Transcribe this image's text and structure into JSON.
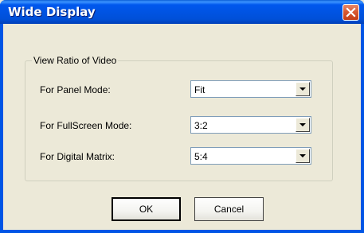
{
  "window": {
    "title": "Wide Display"
  },
  "group": {
    "title": "View Ratio of Video"
  },
  "rows": [
    {
      "label": "For Panel Mode:",
      "value": "Fit"
    },
    {
      "label": "For FullScreen Mode:",
      "value": "3:2"
    },
    {
      "label": "For Digital Matrix:",
      "value": "5:4"
    }
  ],
  "buttons": {
    "ok": "OK",
    "cancel": "Cancel"
  },
  "icons": {
    "close": "close-icon",
    "dropdown": "chevron-down-icon"
  },
  "colors": {
    "titlebar": "#0054e3",
    "close_button": "#d8532a",
    "dialog_bg": "#ece9d8"
  }
}
